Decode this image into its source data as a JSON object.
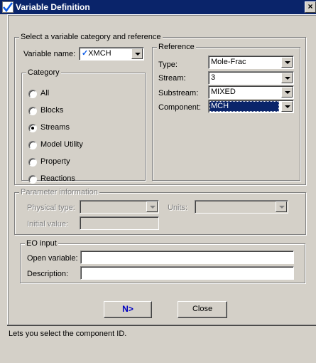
{
  "window": {
    "title": "Variable Definition",
    "close_glyph": "×"
  },
  "select_group": {
    "label": "Select a variable category and reference"
  },
  "variable_name": {
    "label": "Variable name:",
    "value": "XMCH"
  },
  "category": {
    "label": "Category",
    "options": [
      "All",
      "Blocks",
      "Streams",
      "Model Utility",
      "Property",
      "Reactions"
    ],
    "selected": "Streams"
  },
  "reference": {
    "label": "Reference",
    "type_label": "Type:",
    "type_value": "Mole-Frac",
    "stream_label": "Stream:",
    "stream_value": "3",
    "substream_label": "Substream:",
    "substream_value": "MIXED",
    "component_label": "Component:",
    "component_value": "MCH"
  },
  "parameter_info": {
    "label": "Parameter information",
    "physical_type_label": "Physical type:",
    "units_label": "Units:",
    "initial_value_label": "Initial value:"
  },
  "eo_input": {
    "label": "EO input",
    "open_variable_label": "Open variable:",
    "open_variable_value": "",
    "description_label": "Description:",
    "description_value": ""
  },
  "buttons": {
    "next": "N>",
    "close": "Close"
  },
  "status_text": "Lets you select the component ID.",
  "colors": {
    "titlebar": "#0a246a",
    "face": "#d4d0c8",
    "selection": "#0a246a",
    "next_text": "#0000c0"
  }
}
